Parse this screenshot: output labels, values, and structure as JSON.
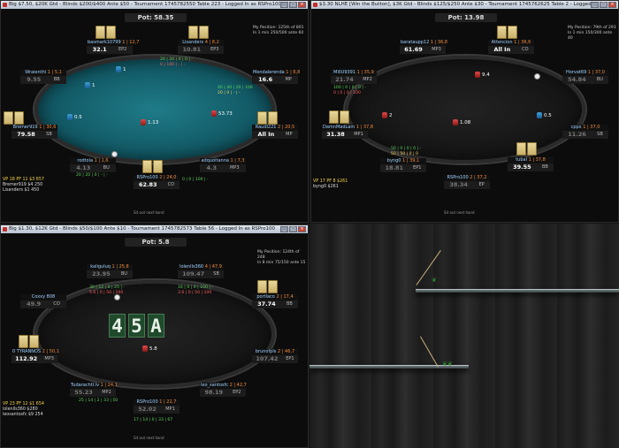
{
  "tables": [
    {
      "title": "Big $7.50, $20K Gtd - Blinds $200/$400 Ante $50 - Tournament 1745782550 Table 223 - Logged In as RSPro100",
      "pot": "Pot: 58.35",
      "my_position": [
        "My Position: 125th of 801",
        "In 1 min 250/500 ante 60"
      ],
      "seats": [
        {
          "name": "basmark10799",
          "tag": "1 | 12,7",
          "stack": "32.1",
          "pos": "EP2"
        },
        {
          "name": "Lisanders",
          "tag": "4 | 8,2",
          "stack": "10.81",
          "pos": "EP3"
        },
        {
          "name": "Mendalerenda",
          "tag": "1 | 6,8",
          "stack": "16.6",
          "pos": "MP"
        },
        {
          "name": "Raudl221",
          "tag": "2 | 20,5",
          "stack": "All In",
          "pos": "MP"
        },
        {
          "name": "adquoitanna",
          "tag": "1 | 7,3",
          "stack": "4.3",
          "pos": "MP3"
        },
        {
          "name": "RSPro100",
          "tag": "2 | 24,0",
          "stack": "62.83",
          "pos": "CO"
        },
        {
          "name": "rodtola",
          "tag": "1 | 1,6",
          "stack": "4.13",
          "pos": "BU"
        },
        {
          "name": "Bremer919",
          "tag": "1 | 30,6",
          "stack": "79.58",
          "pos": "SB"
        },
        {
          "name": "Wraienthi",
          "tag": "1 | 5,1",
          "stack": "9.55",
          "pos": "BB"
        }
      ],
      "bets": [
        "1",
        "1",
        "0.5",
        "1.13",
        "53.73"
      ],
      "bottom_left": [
        "VP 18  PF 11  $3 657",
        "Bremer919  $4 250",
        "Lisanders  $1 450"
      ],
      "hud": [
        "20 | 20 | 0 | 0 | -",
        "0 | 100 | - | -",
        "40 | 40 | 20 | 100",
        "20 | 0 | - | -",
        "20 | 20 | 0 | - | -",
        "0 | 0 | 100 | -"
      ],
      "sit_out": "Sit out next hand"
    },
    {
      "title": "$3.30 NLHE [Win the Button], $3K Gtd - Blinds $125/$250 Ante $30 - Tournament 1745762625 Table 2 - Logged...",
      "pot": "Pot: 13.98",
      "my_position": [
        "My Position: 79th of 293",
        "In 1 min 150/300 ante 40"
      ],
      "seats": [
        {
          "name": "barataupp12",
          "tag": "1 | 36,8",
          "stack": "61.69",
          "pos": "MP3"
        },
        {
          "name": "Attencion",
          "tag": "1 | 36,6",
          "stack": "All In",
          "pos": "CO"
        },
        {
          "name": "Horvat69",
          "tag": "1 | 37,0",
          "stack": "54.84",
          "pos": "BU"
        },
        {
          "name": "cppx",
          "tag": "1 | 37,0",
          "stack": "11.26",
          "pos": "SB"
        },
        {
          "name": "tubal",
          "tag": "1 | 37,8",
          "stack": "39.55",
          "pos": "BB"
        },
        {
          "name": "RSPro100",
          "tag": "2 | 37,2",
          "stack": "38.34",
          "pos": "EP"
        },
        {
          "name": "byng0",
          "tag": "1 | 39,1",
          "stack": "18.81",
          "pos": "EP1"
        },
        {
          "name": "DamnMadLam",
          "tag": "1 | 37,8",
          "stack": "31.38",
          "pos": "MP1"
        },
        {
          "name": "MillU9391",
          "tag": "1 | 35,9",
          "stack": "21.74",
          "pos": "MP2"
        }
      ],
      "bets": [
        "9.4",
        "2",
        "0.5",
        "1.08"
      ],
      "bottom_left": [
        "VP 17  PF 8  $261",
        "byng0  $261"
      ],
      "hud": [
        "100 | 0 | 0 | 0 | -",
        "0 | 0 | 0 | 100",
        "50 | 0 | 0 | 0 | -",
        "50 | 50 | 0 | 0"
      ],
      "sit_out": "Sit out next hand"
    },
    {
      "title": "Big $1.30, $12K Gtd - Blinds $50/$100 Ante $10 - Tournament 1745782573 Table 56 - Logged In as RSPro100",
      "pot": "Pot: 5.8",
      "my_position": [
        "My Position: 124th of 248",
        "In 8 min 75/150 ante 15"
      ],
      "seats": [
        {
          "name": "kaliguluq",
          "tag": "1 | 25,8",
          "stack": "23.95",
          "pos": "BU"
        },
        {
          "name": "lolenlls360",
          "tag": "4 | 47,9",
          "stack": "109.47",
          "pos": "SB"
        },
        {
          "name": "portlaco",
          "tag": "2 | 17,4",
          "stack": "37.74",
          "pos": "BB"
        },
        {
          "name": "brunofpls",
          "tag": "2 | 46,7",
          "stack": "107.42",
          "pos": "EP1"
        },
        {
          "name": "leo_santosfc",
          "tag": "2 | 42,7",
          "stack": "98.19",
          "pos": "EP2"
        },
        {
          "name": "RSPro100",
          "tag": "1 | 22,7",
          "stack": "52.02",
          "pos": "MP1"
        },
        {
          "name": "Tudarachtl.lv",
          "tag": "1 | 24,1",
          "stack": "55.23",
          "pos": "MP2"
        },
        {
          "name": "0 TYRANNOS",
          "tag": "2 | 50,1",
          "stack": "112.92",
          "pos": "MP3"
        },
        {
          "name": "Coxxy 808",
          "tag": "",
          "stack": "49.9",
          "pos": "CO"
        }
      ],
      "board": [
        "4",
        "5",
        "A"
      ],
      "bets": [
        "5.8"
      ],
      "bottom_left": [
        "VP 23  PF 12  $1 654",
        "lolenlls360  $280",
        "leosantosfc  $9 254"
      ],
      "hud": [
        "30 | 12 | 0 | 25 | -",
        "5.6 | 0 | 50 | 100",
        "16 | 0 | 0 | 100 | -",
        "3.6 | 0 | 50 | 100",
        "25 | 14 | 2 | 33 | 50",
        "17 | 14 | 0 | 33 | 67"
      ],
      "sit_out": "Sit out next hand"
    }
  ]
}
